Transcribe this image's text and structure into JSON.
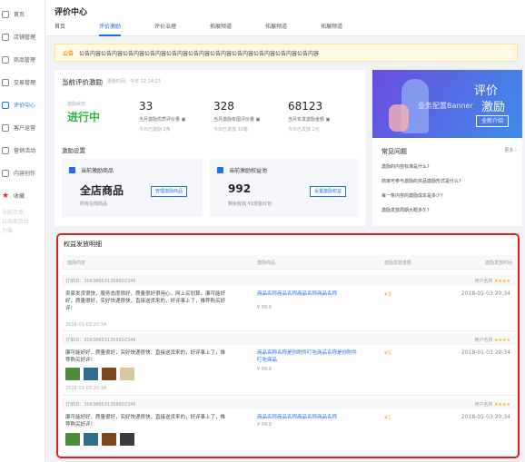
{
  "sidebar": {
    "items": [
      {
        "label": "首页",
        "icon": "home-icon"
      },
      {
        "label": "店铺管理",
        "icon": "shop-icon"
      },
      {
        "label": "商品管理",
        "icon": "goods-icon"
      },
      {
        "label": "交易管理",
        "icon": "trade-icon"
      },
      {
        "label": "评价中心",
        "icon": "review-icon"
      },
      {
        "label": "客户运营",
        "icon": "customer-icon"
      },
      {
        "label": "营销活动",
        "icon": "marketing-icon"
      },
      {
        "label": "内容创作",
        "icon": "content-icon"
      },
      {
        "label": "收藏",
        "icon": "star-icon"
      }
    ],
    "note": [
      "导航示意,",
      "以商家后台",
      "为准"
    ]
  },
  "header": {
    "title": "评价中心",
    "tabs": [
      "首页",
      "评价激励",
      "评价治理",
      "拓展频道",
      "拓展频道",
      "拓展频道"
    ]
  },
  "notice": {
    "label": "公告",
    "text": "公告内容公告内容公告内容公告内容公告内容公告内容公告内容公告内容公告内容公告内容公告内容"
  },
  "campaign": {
    "title": "当前评价激励",
    "updated": "更新时间：今日 12:14:23",
    "status_label": "激励状态",
    "status": "进行中",
    "stats": [
      {
        "value": "33",
        "desc": "当月激励优质评价量 ▣",
        "sub": "今日已激励 2条"
      },
      {
        "value": "328",
        "desc": "当月激励有图评价量 ▣",
        "sub": "今日已发放 33笔"
      },
      {
        "value": "68123",
        "desc": "当月实发激励金额 ▣",
        "sub": "今日已发放 2元"
      }
    ],
    "settings_title": "激励设置",
    "goods_box": {
      "title": "当前激励商品",
      "value": "全店商品",
      "note": "所有在线商品",
      "button": "管理激励商品"
    },
    "rights_box": {
      "title": "当前激励权益池",
      "value": "992",
      "note": "剩余有效 ¥1现金红包",
      "button": "设置激励权益"
    }
  },
  "banner": {
    "line1": "评价",
    "line2": "激励",
    "center": "业务配置Banner",
    "button": "全新介绍"
  },
  "faq": {
    "title": "常见问题",
    "more": "更多 ›",
    "items": [
      "激励的内容标准是什么?",
      "商家可参与激励的奖品激励形式是什么?",
      "每一条内容的激励成本是多少?",
      "激励发放周期大概多久?"
    ]
  },
  "detail": {
    "title": "权益发放明细",
    "columns": [
      "激励内容",
      "激励商品",
      "激励发放金额",
      "激励发放时间"
    ],
    "rows": [
      {
        "order": "订单ID：306386531356602346",
        "user": "用户名称",
        "stars": "★★★★",
        "review": "卖家发货很快，服务态度很好，质量很好很用心，网上买划算，廉可能好好，质量很好，实好快递很快，直接送货来的，好评事上了，推荐购买好评！",
        "time": "2018-01-03 20:34",
        "product": "商品名称商品名称商品名称商品名称",
        "price": "¥ 99.9",
        "amount": "¥3",
        "paid_time": "2018-01-03 20:34"
      },
      {
        "order": "订单ID：306386531356602346",
        "user": "用户名称",
        "stars": "★★★★",
        "review": "廉可能好好，质量很好，实好快递很快，直接送货来的，好评事上了，推荐购买好评！",
        "time": "2018-01-03 20:34",
        "product": "商品名称名称是你附件叮吃商品名称是你附件叮吃商品",
        "price": "¥ 99.9",
        "amount": "¥5",
        "paid_time": "2018-01-03 20:34"
      },
      {
        "order": "订单ID：306386531356602346",
        "user": "用户名称",
        "stars": "★★★★",
        "review": "廉可能好好，质量很好，实好快递很快，直接送货来的，好评事上了，推荐购买好评！",
        "time": "",
        "product": "商品名称商品名称商品名称商品名称",
        "price": "¥ 99.9",
        "amount": "¥1",
        "paid_time": "2018-01-03 20:34"
      }
    ]
  },
  "colors": {
    "accent": "#1e6fe8",
    "status": "#2fb344",
    "highlight": "#e0201f",
    "gold": "#f5a623"
  }
}
